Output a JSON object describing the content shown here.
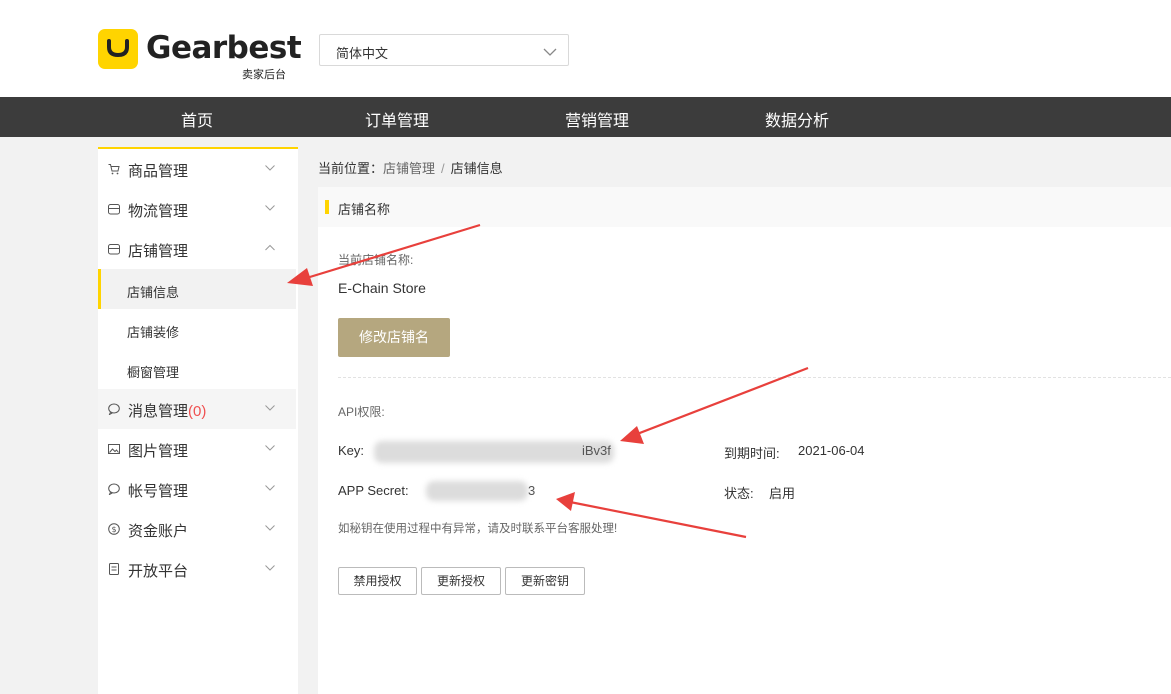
{
  "brand": {
    "name": "Gearbest",
    "subtitle": "卖家后台"
  },
  "language": {
    "selected": "简体中文"
  },
  "topnav": {
    "items": [
      "首页",
      "订单管理",
      "营销管理",
      "数据分析"
    ]
  },
  "sidebar": {
    "items": [
      {
        "label": "商品管理",
        "icon": "cart-icon",
        "expanded": false
      },
      {
        "label": "物流管理",
        "icon": "box-icon",
        "expanded": false
      },
      {
        "label": "店铺管理",
        "icon": "store-icon",
        "expanded": true
      },
      {
        "label": "消息管理",
        "count": "(0)",
        "icon": "chat-icon",
        "expanded": false
      },
      {
        "label": "图片管理",
        "icon": "image-icon",
        "expanded": false
      },
      {
        "label": "帐号管理",
        "icon": "chat-icon",
        "expanded": false
      },
      {
        "label": "资金账户",
        "icon": "dollar-icon",
        "expanded": false
      },
      {
        "label": "开放平台",
        "icon": "document-icon",
        "expanded": false
      }
    ],
    "subitems": [
      {
        "label": "店铺信息",
        "active": true
      },
      {
        "label": "店铺装修",
        "active": false
      },
      {
        "label": "橱窗管理",
        "active": false
      }
    ]
  },
  "breadcrumb": {
    "prefix": "当前位置：",
    "parent": "店铺管理",
    "separator": "/",
    "current": "店铺信息"
  },
  "section": {
    "title": "店铺名称",
    "current_name_label": "当前店铺名称:",
    "store_name": "E-Chain Store",
    "edit_button": "修改店铺名"
  },
  "api": {
    "label": "API权限:",
    "key_label": "Key:",
    "key_visible_suffix": "iBv3f",
    "secret_label": "APP Secret:",
    "secret_visible_suffix": "3",
    "expiry_label": "到期时间:",
    "expiry_value": "2021-06-04",
    "status_label": "状态:",
    "status_value": "启用",
    "note": "如秘钥在使用过程中有异常，请及时联系平台客服处理!",
    "buttons": [
      "禁用授权",
      "更新授权",
      "更新密钥"
    ]
  },
  "colors": {
    "accent": "#ffd400",
    "nav_bg": "#3c3c3c",
    "edit_button": "#b5a77f",
    "annotation_arrow": "#e8403c"
  }
}
